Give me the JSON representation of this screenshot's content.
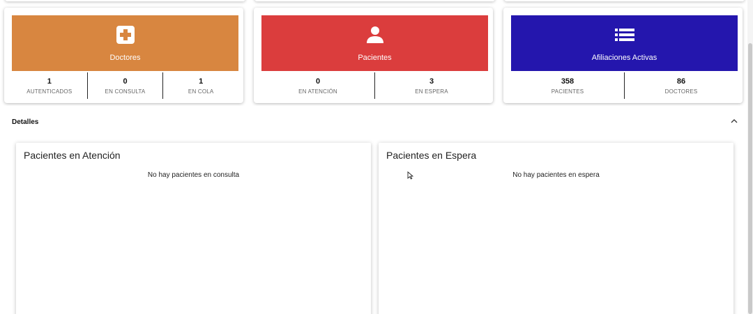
{
  "summary_cards": [
    {
      "title": "Doctores",
      "color": "#d88640",
      "icon": "medical-plus-icon",
      "stats": [
        {
          "value": "1",
          "label": "AUTENTICADOS"
        },
        {
          "value": "0",
          "label": "EN CONSULTA"
        },
        {
          "value": "1",
          "label": "EN COLA"
        }
      ]
    },
    {
      "title": "Pacientes",
      "color": "#db3d3d",
      "icon": "person-icon",
      "stats": [
        {
          "value": "0",
          "label": "EN ATENCIÓN"
        },
        {
          "value": "3",
          "label": "EN ESPERA"
        }
      ]
    },
    {
      "title": "Afiliaciones Activas",
      "color": "#2416ad",
      "icon": "list-icon",
      "stats": [
        {
          "value": "358",
          "label": "PACIENTES"
        },
        {
          "value": "86",
          "label": "DOCTORES"
        }
      ]
    }
  ],
  "details": {
    "title": "Detalles",
    "collapse_icon": "chevron-up-icon"
  },
  "panels": {
    "attention": {
      "title": "Pacientes en Atención",
      "empty": "No hay pacientes en consulta"
    },
    "waiting": {
      "title": "Pacientes en Espera",
      "empty": "No hay pacientes en espera"
    }
  }
}
